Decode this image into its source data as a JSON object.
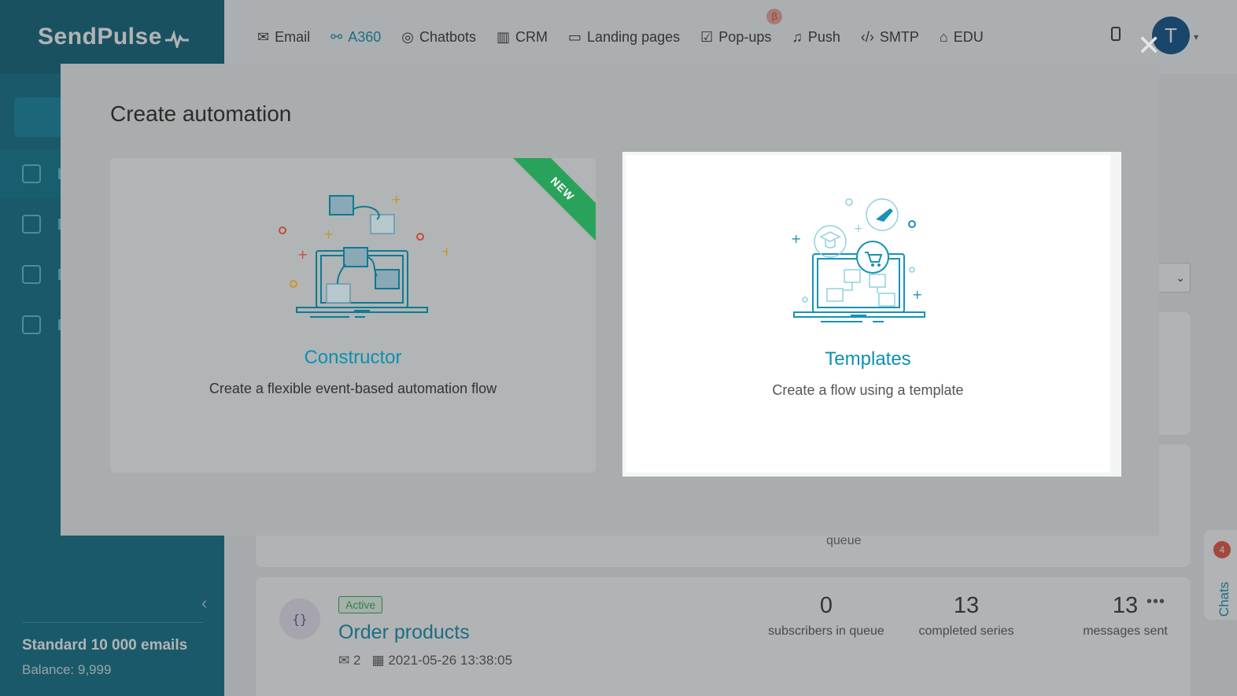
{
  "sidebar": {
    "logo": "SendPulse",
    "plan": "Standard 10 000 emails",
    "balance": "Balance: 9,999"
  },
  "topnav": {
    "items": [
      {
        "label": "Email",
        "icon": "envelope-icon"
      },
      {
        "label": "A360",
        "icon": "nodes-icon"
      },
      {
        "label": "Chatbots",
        "icon": "chat-icon"
      },
      {
        "label": "CRM",
        "icon": "crm-icon"
      },
      {
        "label": "Landing pages",
        "icon": "landing-icon"
      },
      {
        "label": "Pop-ups",
        "icon": "popup-icon"
      },
      {
        "label": "Push",
        "icon": "bell-icon"
      },
      {
        "label": "SMTP",
        "icon": "code-icon"
      },
      {
        "label": "EDU",
        "icon": "graduation-icon"
      }
    ],
    "beta": "β",
    "avatar_letter": "T"
  },
  "modal": {
    "title": "Create automation",
    "close": "✕",
    "options": [
      {
        "title": "Constructor",
        "description": "Create a flexible event-based automation flow",
        "ribbon": "NEW"
      },
      {
        "title": "Templates",
        "description": "Create a flow using a template"
      }
    ]
  },
  "background": {
    "queue_label": "queue",
    "flow": {
      "status": "Active",
      "name": "Order products",
      "emails": "2",
      "date": "2021-05-26 13:38:05",
      "stats": [
        {
          "value": "0",
          "label": "subscribers in queue"
        },
        {
          "value": "13",
          "label": "completed series"
        },
        {
          "value": "13",
          "label": "messages sent"
        }
      ]
    },
    "chats": {
      "label": "Chats",
      "count": "4"
    }
  },
  "colors": {
    "sidebar": "#0c6f86",
    "accent": "#0e8fb1",
    "active_badge": "#2eaa52",
    "ribbon": "#2aa35a"
  }
}
